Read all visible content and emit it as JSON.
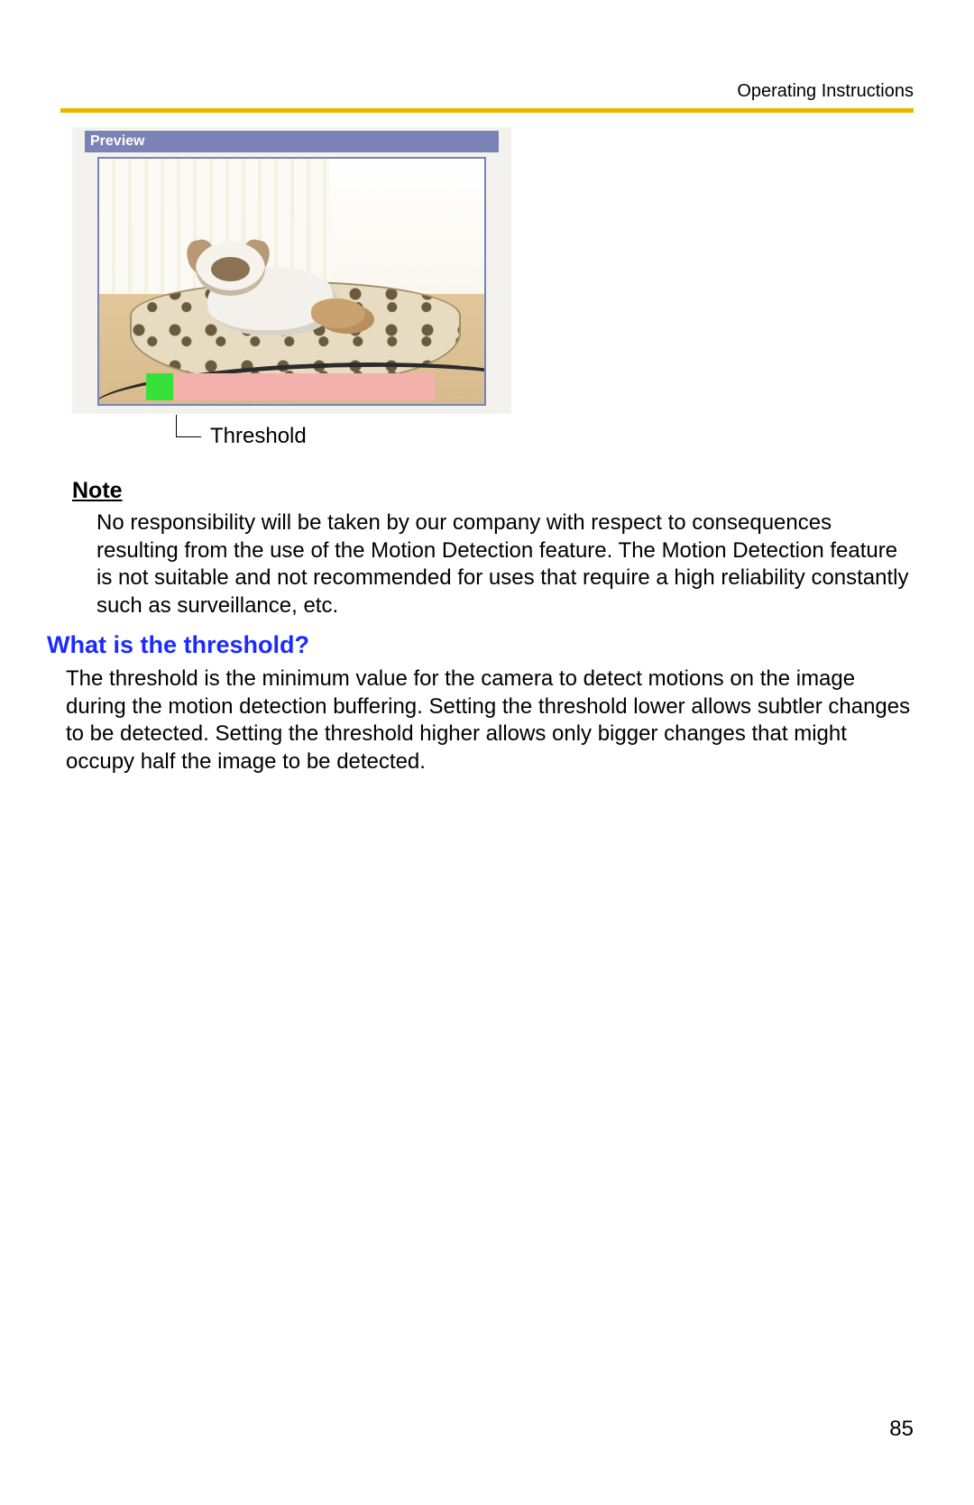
{
  "header": {
    "label": "Operating Instructions"
  },
  "preview": {
    "title": "Preview",
    "threshold_label": "Threshold"
  },
  "note": {
    "heading": "Note",
    "body": "No responsibility will be taken by our company with respect to consequences resulting from the use of the Motion Detection feature. The Motion Detection feature is not suitable and not recommended for uses that require a high reliability constantly such as surveillance, etc."
  },
  "section": {
    "heading": "What is the threshold?",
    "body": "The threshold is the minimum value for the camera to detect motions on the image during the motion detection buffering. Setting the threshold lower allows subtler changes to be detected. Setting the threshold higher allows only bigger changes that might occupy half the image to be detected."
  },
  "page_number": "85"
}
